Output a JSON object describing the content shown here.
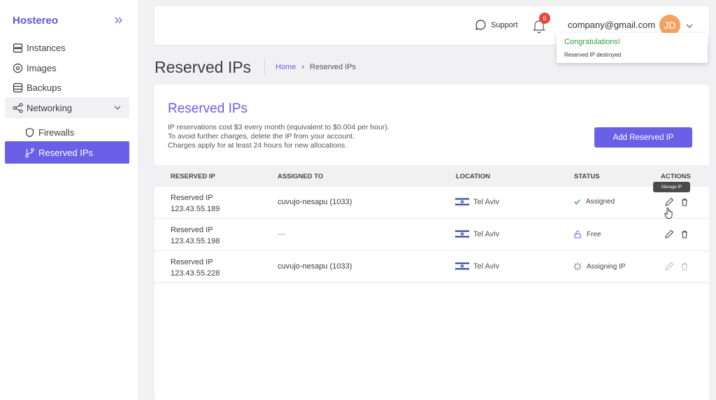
{
  "app": {
    "brand": "Hostereo"
  },
  "sidebar": {
    "items": [
      {
        "label": "Instances"
      },
      {
        "label": "Images"
      },
      {
        "label": "Backups"
      },
      {
        "label": "Networking"
      },
      {
        "label": "Firewalls"
      },
      {
        "label": "Reserved IPs"
      }
    ]
  },
  "topbar": {
    "support_label": "Support",
    "notification_count": "6",
    "user_email": "company@gmail.com",
    "avatar_initials": "JD"
  },
  "toast": {
    "title": "Congratulations!",
    "message": "Reserved IP destroyed"
  },
  "page": {
    "title": "Reserved IPs",
    "breadcrumb": {
      "home": "Home",
      "separator": "›",
      "current": "Reserved IPs"
    }
  },
  "card": {
    "title": "Reserved IPs",
    "description": [
      "IP reservations cost $3 every month (equivalent to $0.004 per hour).",
      "To avoid further charges, delete the IP from your account.",
      "Charges apply for at least 24 hours for new allocations."
    ],
    "add_button_label": "Add Reserved IP"
  },
  "table": {
    "columns": [
      "RESERVED IP",
      "ASSIGNED TO",
      "LOCATION",
      "STATUS",
      "ACTIONS"
    ],
    "rows": [
      {
        "name": "Reserved IP",
        "ip": "123.43.55.189",
        "assigned": "cuvujo-nesapu (1033)",
        "location": "Tel Aviv",
        "status": "Assigned",
        "status_icon": "check-icon"
      },
      {
        "name": "Reserved IP",
        "ip": "123.43.55.198",
        "assigned": "—",
        "location": "Tel Aviv",
        "status": "Free",
        "status_icon": "unlock-icon"
      },
      {
        "name": "Reserved IP",
        "ip": "123.43.55.228",
        "assigned": "cuvujo-nesapu (1033)",
        "location": "Tel Aviv",
        "status": "Assigning IP",
        "status_icon": "spinner-icon"
      }
    ],
    "tooltip": "Manage IP"
  },
  "colors": {
    "accent": "#6a60e8",
    "success": "#2f9e44",
    "danger": "#e5483f",
    "avatar": "#f4a261"
  }
}
